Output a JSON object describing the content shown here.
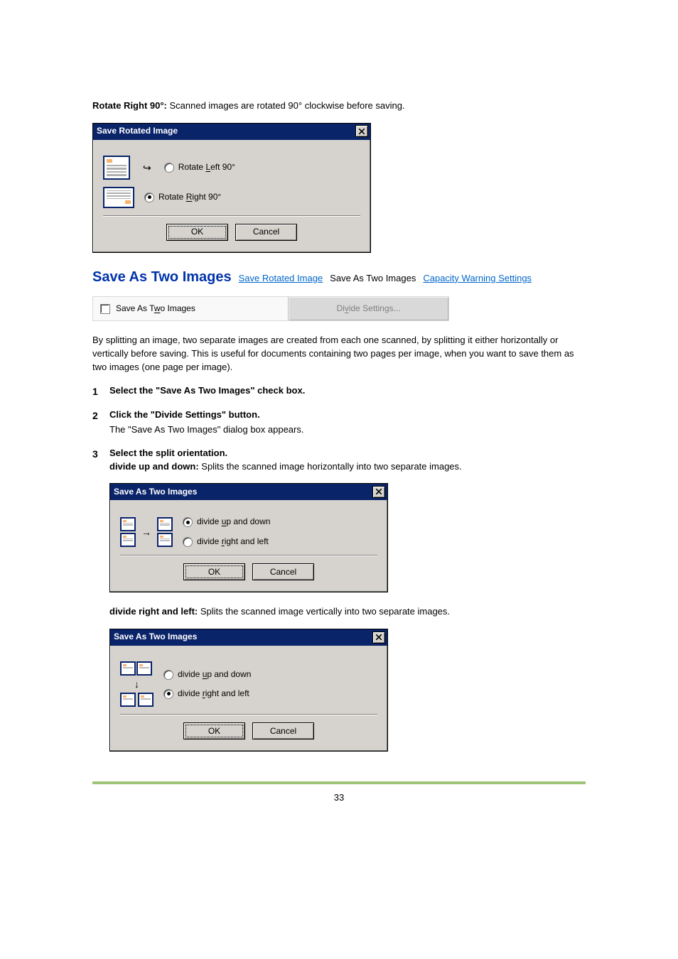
{
  "intro": {
    "rotate_right_label": "Rotate Right 90°:",
    "rotate_right_desc": " Scanned images are rotated 90° clockwise before saving."
  },
  "rotate_dialog": {
    "title": "Save Rotated Image",
    "rotate_left_prefix": "Rotate ",
    "rotate_left_key": "L",
    "rotate_left_suffix": "eft 90°",
    "rotate_right_prefix": "Rotate ",
    "rotate_right_key": "R",
    "rotate_right_suffix": "ight 90°",
    "ok": "OK",
    "cancel": "Cancel"
  },
  "section": {
    "title": "Save As Two Images",
    "nav_prev": "Save Rotated Image",
    "nav_current": "Save As Two Images",
    "nav_next": "Capacity Warning Settings"
  },
  "strip": {
    "chk_prefix": "Save As T",
    "chk_key": "w",
    "chk_suffix": "o Images",
    "btn_prefix": "Di",
    "btn_key": "v",
    "btn_suffix": "ide Settings..."
  },
  "body1": "By splitting an image, two separate images are created from each one scanned, by splitting it either horizontally or vertically before saving. This is useful for documents containing two pages per image, when you want to save them as two images (one page per image).",
  "steps": {
    "s1": {
      "num": "1",
      "head": "Select the \"Save As Two Images\" check box."
    },
    "s2": {
      "num": "2",
      "head": "Click the \"Divide Settings\" button.",
      "sub": "The \"Save As Two Images\" dialog box appears."
    },
    "s3": {
      "num": "3",
      "head": "Select the split orientation.",
      "line1_label": "divide up and down:",
      "line1_desc": " Splits the scanned image horizontally into two separate images.",
      "line2_label": "divide right and left:",
      "line2_desc": " Splits the scanned image vertically into two separate images."
    }
  },
  "two_dialog": {
    "title": "Save As Two Images",
    "upd_prefix": "divide ",
    "upd_key": "u",
    "upd_suffix": "p and down",
    "lr_prefix": "divide ",
    "lr_key": "r",
    "lr_suffix": "ight and left",
    "ok": "OK",
    "cancel": "Cancel"
  },
  "page_number": "33"
}
